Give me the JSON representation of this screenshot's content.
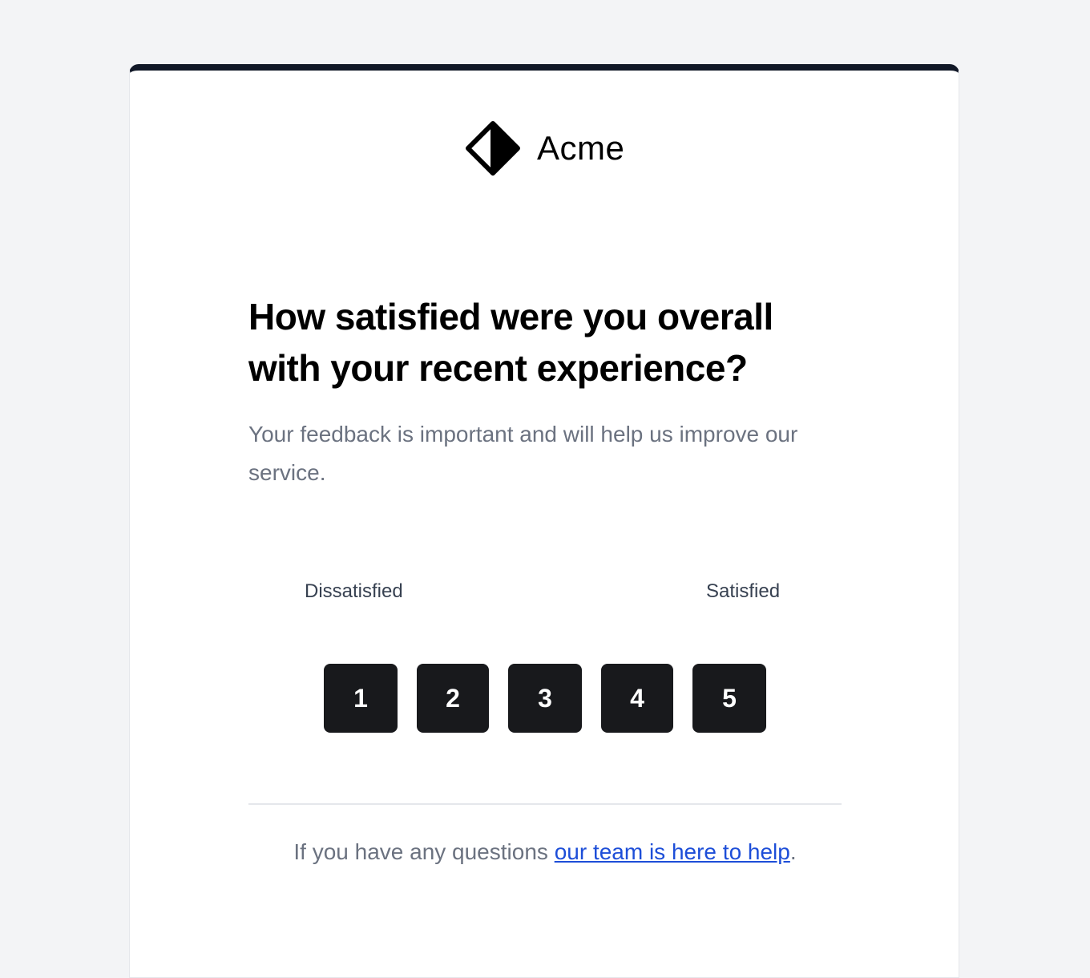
{
  "brand": {
    "name": "Acme",
    "logo_icon": "diamond-logo-icon",
    "accent_color": "#111827"
  },
  "survey": {
    "question": "How satisfied were you overall with your recent experience?",
    "description": "Your feedback is important and will help us improve our service.",
    "scale_low_label": "Dissatisfied",
    "scale_high_label": "Satisfied",
    "ratings": [
      "1",
      "2",
      "3",
      "4",
      "5"
    ],
    "button_color": "#18191c"
  },
  "footer": {
    "text_before": "If you have any questions ",
    "link_text": "our team is here to help",
    "text_after": ".",
    "link_color": "#1d4ed8"
  }
}
